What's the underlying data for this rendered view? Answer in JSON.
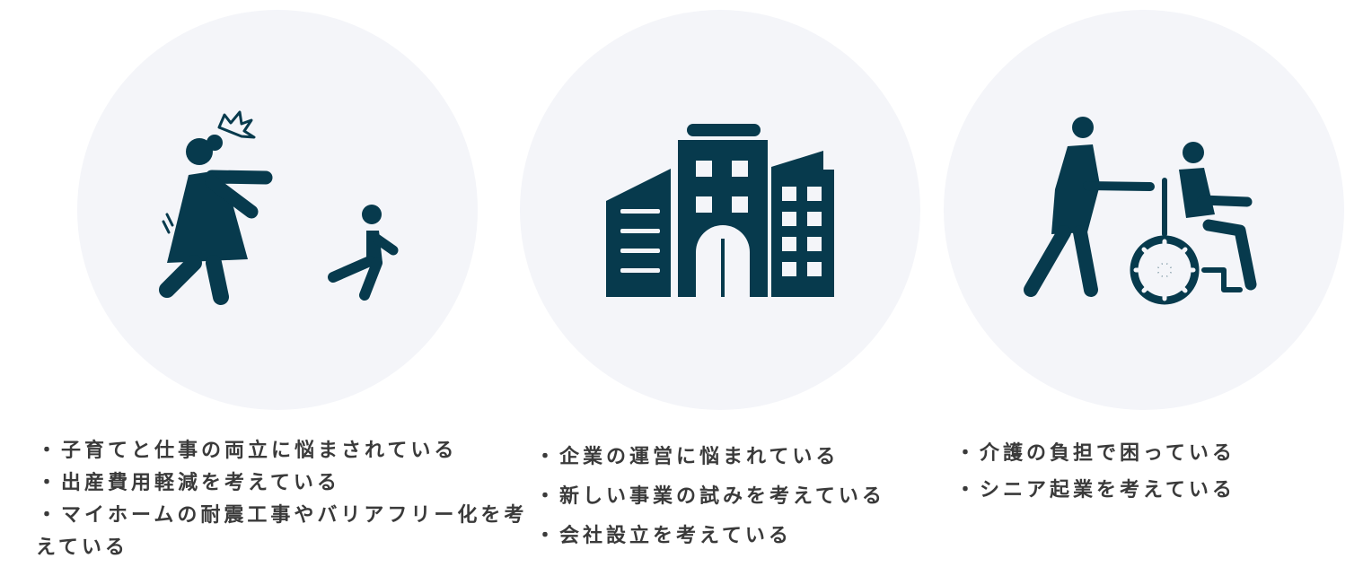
{
  "colors": {
    "icon": "#073a4d",
    "circle": "#f4f5f9",
    "text": "#3a3a3a"
  },
  "cards": [
    {
      "icon": "parent-chasing-child-icon",
      "items": [
        "子育てと仕事の両立に悩まされている",
        "出産費用軽減を考えている",
        "マイホームの耐震工事やバリアフリー化を考えている"
      ]
    },
    {
      "icon": "office-buildings-icon",
      "items": [
        "企業の運営に悩まれている",
        "新しい事業の試みを考えている",
        "会社設立を考えている"
      ]
    },
    {
      "icon": "caregiver-wheelchair-icon",
      "items": [
        "介護の負担で困っている",
        "シニア起業を考えている"
      ]
    }
  ],
  "bullet": "・"
}
